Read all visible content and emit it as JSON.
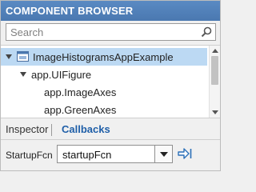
{
  "title": "COMPONENT BROWSER",
  "search": {
    "placeholder": "Search",
    "icon": "magnifier-icon"
  },
  "tree": {
    "items": [
      {
        "label": "ImageHistogramsAppExample",
        "level": 0,
        "expanded": true,
        "selected": true,
        "icon": "app-icon"
      },
      {
        "label": "app.UIFigure",
        "level": 1,
        "expanded": true,
        "selected": false
      },
      {
        "label": "app.ImageAxes",
        "level": 2,
        "selected": false
      },
      {
        "label": "app.GreenAxes",
        "level": 2,
        "selected": false
      }
    ]
  },
  "tabs": {
    "inspector": "Inspector",
    "callbacks": "Callbacks",
    "active": "callbacks"
  },
  "callback": {
    "property": "StartupFcn",
    "value": "startupFcn",
    "goto_icon": "go-to-callback-icon"
  },
  "colors": {
    "titlebar": "#4f81bd",
    "selection": "#bcd9f3",
    "active_tab": "#1f5fa8"
  }
}
